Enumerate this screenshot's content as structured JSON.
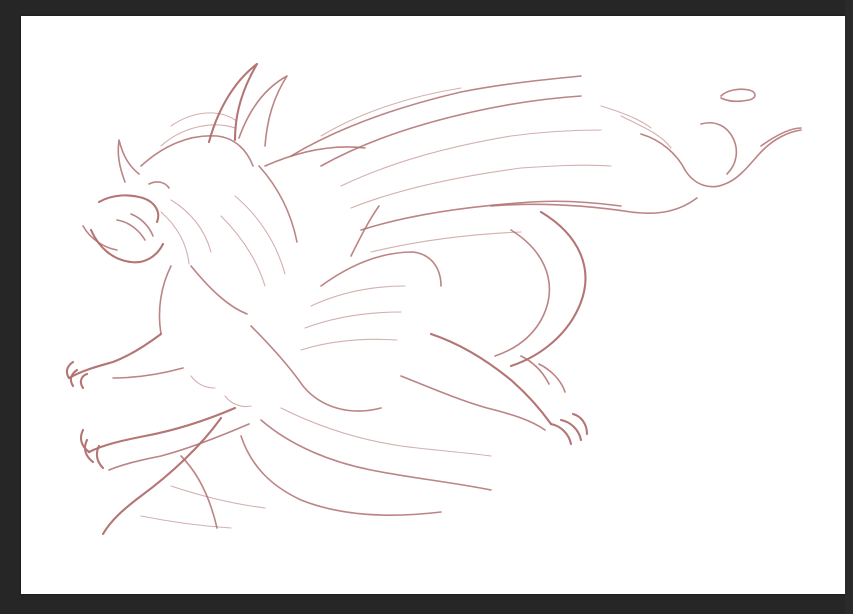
{
  "canvas": {
    "background": "#ffffff",
    "workspace_background": "#262626",
    "sketch_color": "#b06e6e",
    "subject": "dragon-sketch"
  }
}
